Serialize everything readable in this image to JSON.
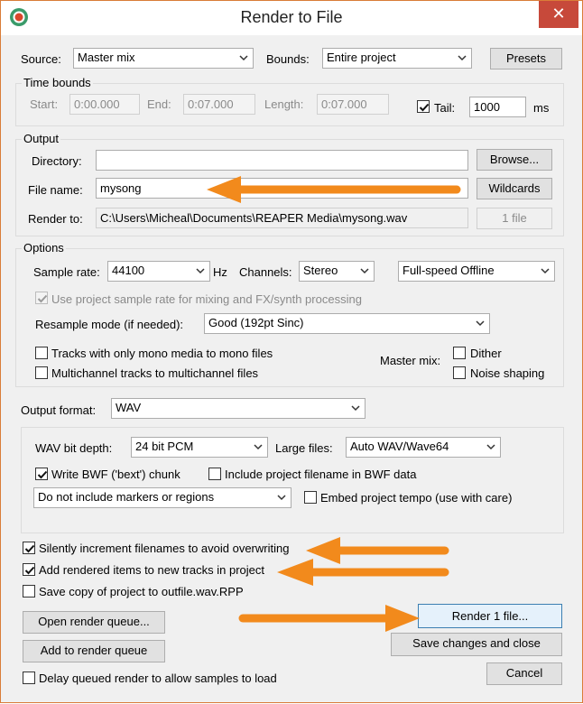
{
  "window": {
    "title": "Render to File",
    "close_glyph": "✕"
  },
  "source": {
    "label": "Source:",
    "value": "Master mix"
  },
  "bounds": {
    "label": "Bounds:",
    "value": "Entire project"
  },
  "presets_label": "Presets",
  "time_bounds": {
    "title": "Time bounds",
    "start_label": "Start:",
    "start_value": "0:00.000",
    "end_label": "End:",
    "end_value": "0:07.000",
    "length_label": "Length:",
    "length_value": "0:07.000",
    "tail_label": "Tail:",
    "tail_checked": true,
    "tail_value": "1000",
    "tail_unit": "ms"
  },
  "output": {
    "title": "Output",
    "directory_label": "Directory:",
    "directory_value": "",
    "browse_label": "Browse...",
    "filename_label": "File name:",
    "filename_value": "mysong",
    "wildcards_label": "Wildcards",
    "render_to_label": "Render to:",
    "render_to_value": "C:\\Users\\Micheal\\Documents\\REAPER Media\\mysong.wav",
    "file_count_label": "1 file"
  },
  "options": {
    "title": "Options",
    "sample_rate_label": "Sample rate:",
    "sample_rate_value": "44100",
    "sample_rate_unit": "Hz",
    "channels_label": "Channels:",
    "channels_value": "Stereo",
    "speed_value": "Full-speed Offline",
    "use_project_rate_label": "Use project sample rate for mixing and FX/synth processing",
    "resample_label": "Resample mode (if needed):",
    "resample_value": "Good (192pt Sinc)",
    "mono_label": "Tracks with only mono media to mono files",
    "multichannel_label": "Multichannel tracks to multichannel files",
    "master_mix_label": "Master mix:",
    "dither_label": "Dither",
    "noise_shaping_label": "Noise shaping"
  },
  "output_format": {
    "label": "Output format:",
    "value": "WAV"
  },
  "wav": {
    "bit_depth_label": "WAV bit depth:",
    "bit_depth_value": "24 bit PCM",
    "large_files_label": "Large files:",
    "large_files_value": "Auto WAV/Wave64",
    "bwf_label": "Write BWF ('bext') chunk",
    "bwf_checked": true,
    "include_filename_label": "Include project filename in BWF data",
    "markers_value": "Do not include markers or regions",
    "embed_tempo_label": "Embed project tempo (use with care)"
  },
  "bottom": {
    "increment_label": "Silently increment filenames to avoid overwriting",
    "add_tracks_label": "Add rendered items to new tracks in project",
    "save_copy_label": "Save copy of project to outfile.wav.RPP",
    "open_queue_label": "Open render queue...",
    "render_label": "Render 1 file...",
    "add_queue_label": "Add to render queue",
    "save_close_label": "Save changes and close",
    "delay_label": "Delay queued render to allow samples to load",
    "cancel_label": "Cancel"
  },
  "colors": {
    "accent_arrow": "#f28a1c",
    "close_red": "#c7493a",
    "window_border": "#d97c38"
  },
  "icons": [
    "reaper-logo-icon",
    "close-icon",
    "dropdown-arrow-icon",
    "checkmark-icon",
    "annotation-arrow-icon"
  ]
}
